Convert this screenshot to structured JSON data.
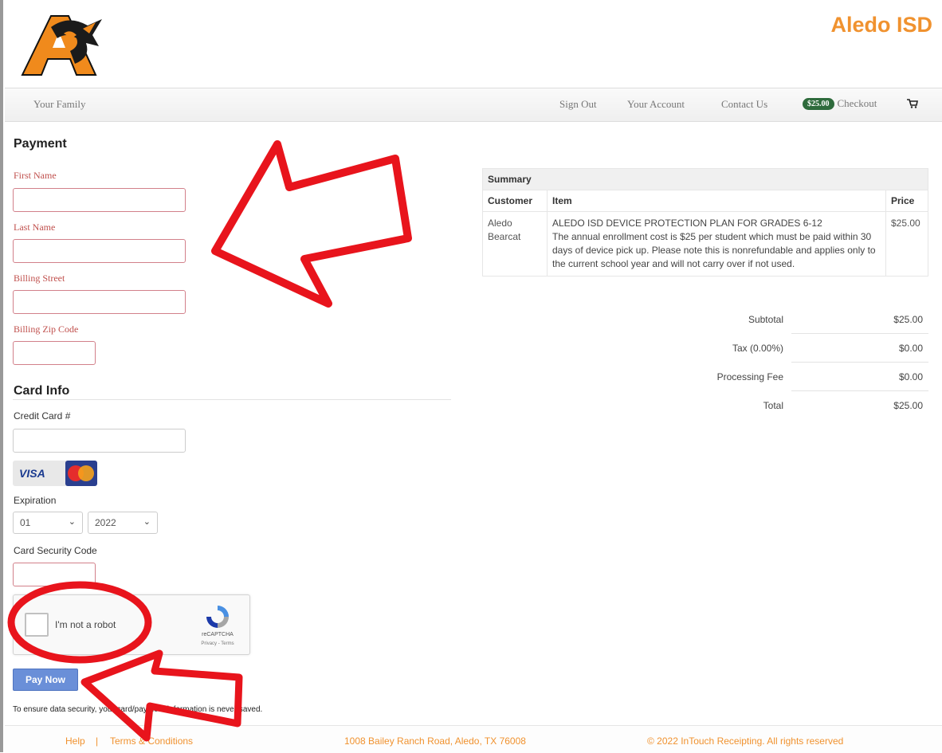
{
  "header": {
    "site_title": "Aledo ISD",
    "logo_letter": "A"
  },
  "nav": {
    "your_family": "Your Family",
    "sign_out": "Sign Out",
    "your_account": "Your Account",
    "contact_us": "Contact Us",
    "cart_amount": "$25.00",
    "checkout": "Checkout"
  },
  "payment": {
    "title": "Payment",
    "first_name_label": "First Name",
    "last_name_label": "Last Name",
    "billing_street_label": "Billing Street",
    "billing_zip_label": "Billing Zip Code"
  },
  "card_info": {
    "title": "Card Info",
    "credit_card_label": "Credit Card #",
    "visa_label": "VISA",
    "expiration_label": "Expiration",
    "exp_month": "01",
    "exp_year": "2022",
    "security_code_label": "Card Security Code"
  },
  "captcha": {
    "text": "I'm not a robot",
    "brand": "reCAPTCHA",
    "terms": "Privacy - Terms"
  },
  "pay_button": "Pay Now",
  "security_note": "To ensure data security, your card/payment information is never saved.",
  "summary": {
    "title": "Summary",
    "headers": {
      "customer": "Customer",
      "item": "Item",
      "price": "Price"
    },
    "row": {
      "customer": "Aledo Bearcat",
      "item_title": "ALEDO ISD DEVICE PROTECTION PLAN FOR GRADES 6-12",
      "item_desc": "The annual enrollment cost is $25 per student which must be paid within 30 days of device pick up. Please note this is nonrefundable and applies only to the current school year and will not carry over if not used.",
      "price": "$25.00"
    },
    "subtotal_label": "Subtotal",
    "subtotal": "$25.00",
    "tax_label": "Tax (0.00%)",
    "tax": "$0.00",
    "fee_label": "Processing Fee",
    "fee": "$0.00",
    "total_label": "Total",
    "total": "$25.00"
  },
  "footer": {
    "help": "Help",
    "sep": "|",
    "terms": "Terms & Conditions",
    "address": "1008 Bailey Ranch Road, Aledo, TX 76008",
    "copyright": "© 2022 InTouch Receipting. All rights reserved"
  },
  "colors": {
    "accent": "#f0922f",
    "annotation": "#e8141c",
    "badge": "#2e6b3c",
    "button": "#6a8fd8"
  }
}
